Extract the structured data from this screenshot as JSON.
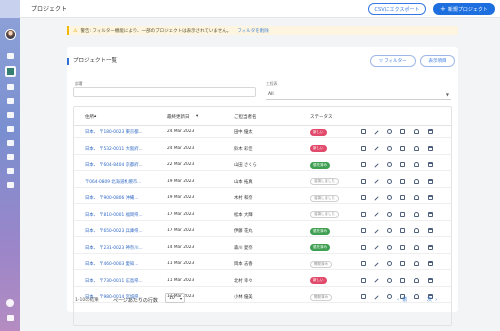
{
  "header": {
    "title": "プロジェクト",
    "export_label": "CSVにエクスポート",
    "new_label": "新規プロジェクト"
  },
  "warning": {
    "text": "警告: フィルター機能により、一部のプロジェクトは表示されていません。",
    "link": "フィルタを削除"
  },
  "list": {
    "title": "プロジェクト一覧",
    "filter_label": "フィルター",
    "display_label": "表示項目",
    "field_name_label": "部署",
    "field_select_label": "工程表",
    "select_value": "All"
  },
  "table": {
    "headers": [
      "住所",
      "最終更新日",
      "ご担当者名",
      "ステータス"
    ],
    "rows": [
      {
        "address": "日本、 〒180-0023 東京都...",
        "date": "24 Mar 2023",
        "person": "田中 優太",
        "status": "新しい",
        "status_type": "red"
      },
      {
        "address": "日本、 〒532-0011 大阪府...",
        "date": "24 Mar 2023",
        "person": "鈴木 彩佳",
        "status": "新しい",
        "status_type": "red"
      },
      {
        "address": "日本、 〒604-8404 京都府...",
        "date": "22 Mar 2023",
        "person": "山田 さくら",
        "status": "優先済み",
        "status_type": "green"
      },
      {
        "address": "〒064-0809 北海道札幌市...",
        "date": "19 Mar 2023",
        "person": "山本 拓真",
        "status": "溶損しました",
        "status_type": "gray"
      },
      {
        "address": "日本、 〒900-0806 沖縄...",
        "date": "19 Mar 2023",
        "person": "木村 和奈",
        "status": "溶損しました",
        "status_type": "gray"
      },
      {
        "address": "日本、 〒810-0001 福岡県...",
        "date": "17 Mar 2023",
        "person": "松本 大輝",
        "status": "溶損しました",
        "status_type": "gray"
      },
      {
        "address": "日本、 〒650-0023 兵庫県...",
        "date": "17 Mar 2023",
        "person": "伊藤 花丸",
        "status": "優先済み",
        "status_type": "green"
      },
      {
        "address": "日本、 〒231-0023 神奈川...",
        "date": "14 Mar 2023",
        "person": "森川 愛奈",
        "status": "優先済み",
        "status_type": "green"
      },
      {
        "address": "日本、 〒460-0003 愛知...",
        "date": "11 Mar 2023",
        "person": "岡本 志香",
        "status": "開発済み",
        "status_type": "gray"
      },
      {
        "address": "日本、 〒730-0011 広島県...",
        "date": "11 Mar 2023",
        "person": "北村 幸々",
        "status": "新しい",
        "status_type": "red"
      },
      {
        "address": "日本、 〒980-0014 宮城県...",
        "date": "11 Mar 2023",
        "person": "小林 優美",
        "status": "開発済み",
        "status_type": "gray"
      }
    ]
  },
  "footer": {
    "range": "1-10の結果",
    "rows_per_page_label": "ページあたりの行数",
    "rows_per_page_value": "10",
    "prev_label": "前",
    "next_label": "次"
  },
  "colors": {
    "primary": "#1d6fe0",
    "badge_red": "#e24a6b",
    "badge_green": "#3f9f52"
  }
}
